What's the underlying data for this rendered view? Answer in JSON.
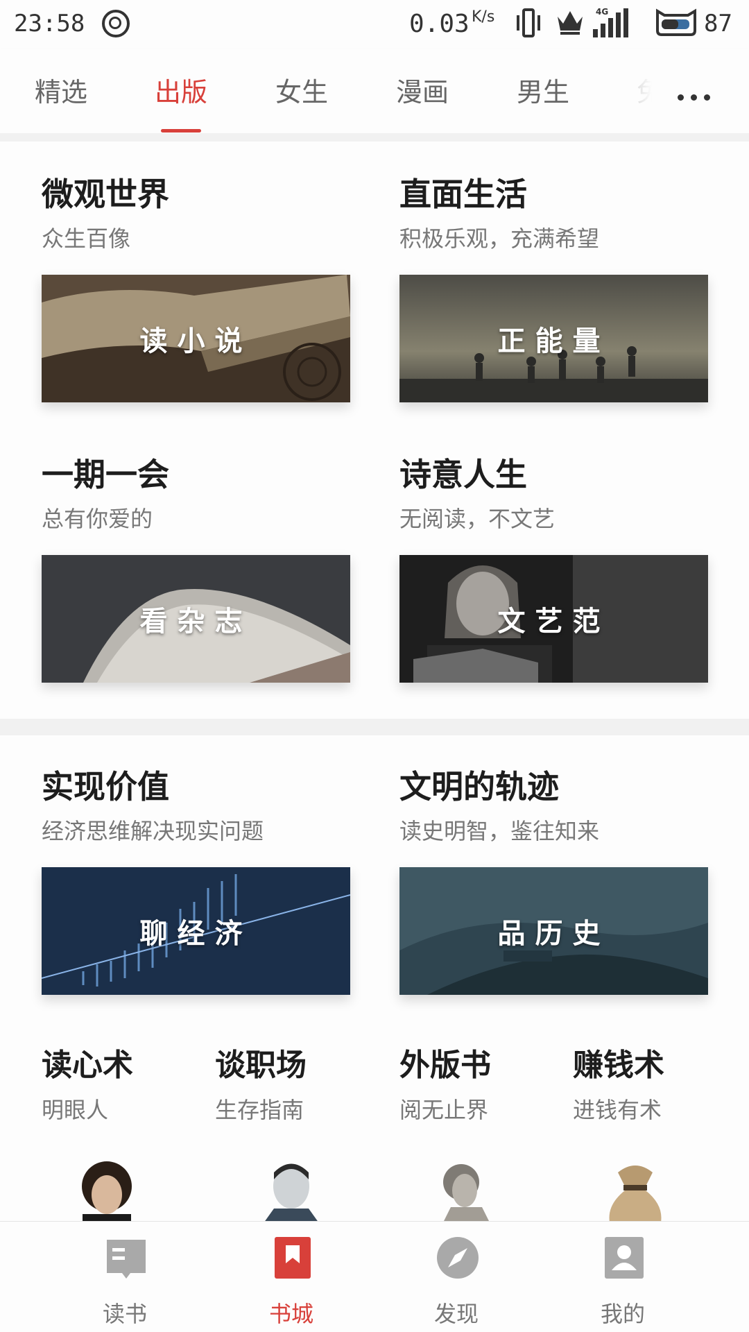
{
  "status_bar": {
    "time": "23:58",
    "net_speed": "0.03",
    "net_unit": "K/s",
    "network_type": "4G",
    "battery": "87"
  },
  "top_tabs": {
    "items": [
      {
        "label": "精选",
        "active": false
      },
      {
        "label": "出版",
        "active": true
      },
      {
        "label": "女生",
        "active": false
      },
      {
        "label": "漫画",
        "active": false
      },
      {
        "label": "男生",
        "active": false
      },
      {
        "label": "免",
        "active": false
      }
    ],
    "more_icon": "more-dots-icon",
    "accent_color": "#d8403a"
  },
  "sections": [
    {
      "cards": [
        {
          "title": "微观世界",
          "subtitle": "众生百像",
          "banner": "读小说"
        },
        {
          "title": "直面生活",
          "subtitle": "积极乐观，充满希望",
          "banner": "正能量"
        },
        {
          "title": "一期一会",
          "subtitle": "总有你爱的",
          "banner": "看杂志"
        },
        {
          "title": "诗意人生",
          "subtitle": "无阅读，不文艺",
          "banner": "文艺范"
        }
      ]
    },
    {
      "cards": [
        {
          "title": "实现价值",
          "subtitle": "经济思维解决现实问题",
          "banner": "聊经济"
        },
        {
          "title": "文明的轨迹",
          "subtitle": "读史明智，鉴往知来",
          "banner": "品历史"
        }
      ],
      "mini_cards": [
        {
          "title": "读心术",
          "subtitle": "明眼人"
        },
        {
          "title": "谈职场",
          "subtitle": "生存指南"
        },
        {
          "title": "外版书",
          "subtitle": "阅无止界"
        },
        {
          "title": "赚钱术",
          "subtitle": "进钱有术"
        }
      ]
    }
  ],
  "bottom_nav": {
    "items": [
      {
        "label": "读书",
        "icon": "book-icon",
        "active": false
      },
      {
        "label": "书城",
        "icon": "bookmark-icon",
        "active": true
      },
      {
        "label": "发现",
        "icon": "compass-icon",
        "active": false
      },
      {
        "label": "我的",
        "icon": "profile-icon",
        "active": false
      }
    ]
  }
}
